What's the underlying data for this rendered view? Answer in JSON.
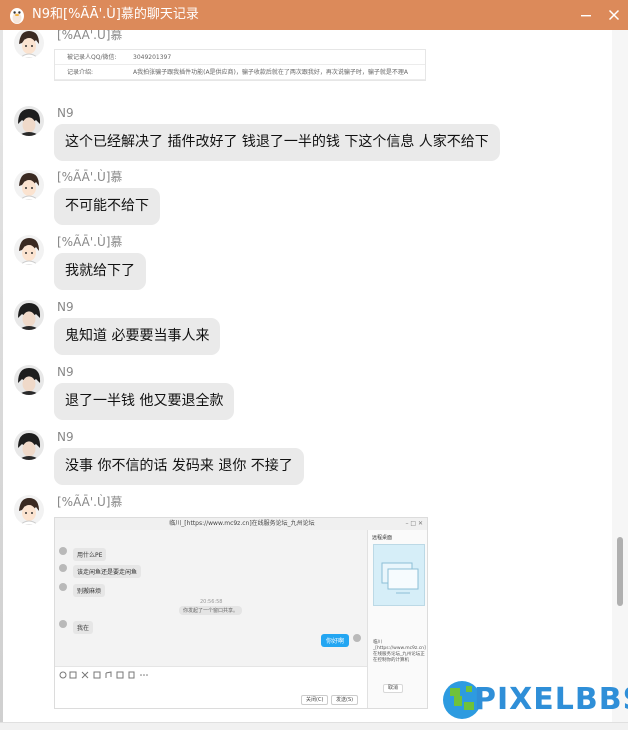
{
  "window": {
    "title": "N9和[%ÃĀ'.Ù]慕的聊天记录",
    "minimize_icon": "minimize-icon",
    "close_icon": "close-icon",
    "titlebar_color": "#dc8a5a"
  },
  "messages": [
    {
      "sender": "[%AA'.U]慕",
      "type": "document",
      "rows": [
        {
          "key": "被记录人QQ/微信:",
          "value": "3049201397"
        },
        {
          "key": "记录介绍:",
          "value": "A我拍张骗子跟我插件功能(A是供应商)，骗子收款后就在了两次跟我好，再次说骗子时，骗子就是不理A"
        }
      ]
    },
    {
      "sender": "N9",
      "text": "这个已经解决了 插件改好了 钱退了一半的钱 下这个信息 人家不给下"
    },
    {
      "sender": "[%ÃĀ'.Ù]慕",
      "text": "不可能不给下"
    },
    {
      "sender": "[%ÃĀ'.Ù]慕",
      "text": "我就给下了"
    },
    {
      "sender": "N9",
      "text": "鬼知道 必要要当事人来"
    },
    {
      "sender": "N9",
      "text": "退了一半钱 他又要退全款"
    },
    {
      "sender": "N9",
      "text": "没事 你不信的话 发码来 退你 不接了"
    },
    {
      "sender": "[%ÃĀ'.Ù]慕",
      "type": "screenshot",
      "screenshot": {
        "title": "临川_[https://www.mc9z.cn]在线服务论坛_九州论坛",
        "bubbles": [
          "用什么PE",
          "该走闲鱼还是要走闲鱼",
          "别搬麻烦",
          "我在"
        ],
        "time": "20:56:58",
        "system_notice": "你发起了一个窗口共享。",
        "blue_bubble": "你好啊",
        "panel_title": "远程桌面",
        "panel_desc": "临川_[https://www.mc9z.cn]在线服务论坛_九州论坛正在控制你的计算机",
        "cancel_label": "取消",
        "close_label": "关闭(C)",
        "send_label": "发送(S)"
      }
    }
  ],
  "watermark": {
    "text": "PIXELBBS"
  }
}
